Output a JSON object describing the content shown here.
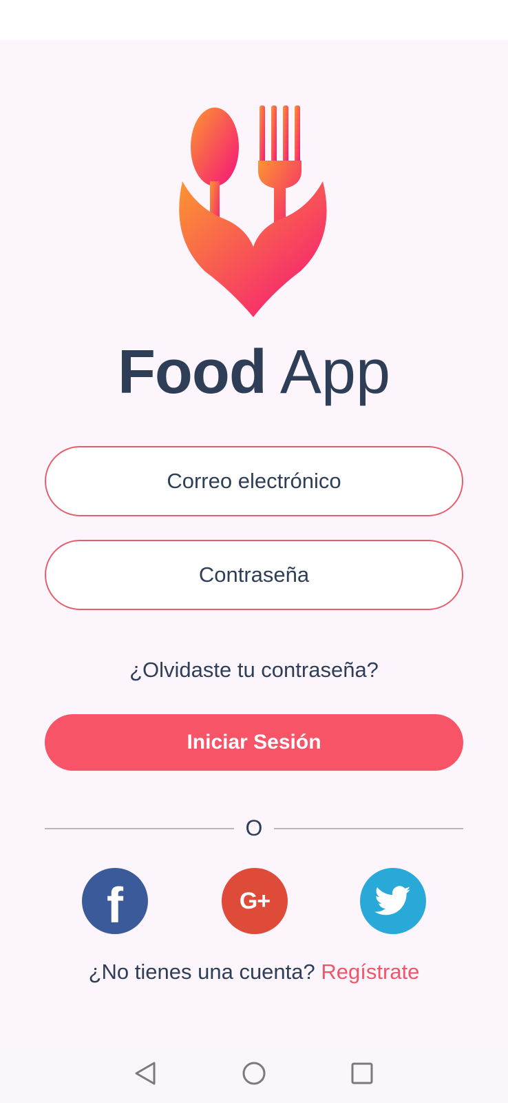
{
  "app": {
    "title_bold": "Food",
    "title_light": "App",
    "logo_icon": "spoon-fork-hands-logo-icon"
  },
  "form": {
    "email_placeholder": "Correo electrónico",
    "password_placeholder": "Contraseña",
    "forgot_password": "¿Olvidaste tu contraseña?",
    "login_label": "Iniciar Sesión"
  },
  "divider": {
    "text": "O"
  },
  "social": [
    {
      "icon": "facebook-icon",
      "color": "#3b5a9a",
      "glyph": "f"
    },
    {
      "icon": "google-plus-icon",
      "color": "#de4b39",
      "glyph": "G+"
    },
    {
      "icon": "twitter-icon",
      "color": "#28a9d8"
    }
  ],
  "signup": {
    "prompt": "¿No tienes una cuenta?",
    "link": "Regístrate"
  },
  "colors": {
    "accent": "#f75467",
    "title": "#2e3e57",
    "background": "#fdf5fc",
    "field_border": "#e45f6c",
    "gradient_start": "#fb9630",
    "gradient_end": "#f5127b"
  },
  "navbar": {
    "items": [
      "back-icon",
      "home-icon",
      "recents-icon"
    ]
  }
}
